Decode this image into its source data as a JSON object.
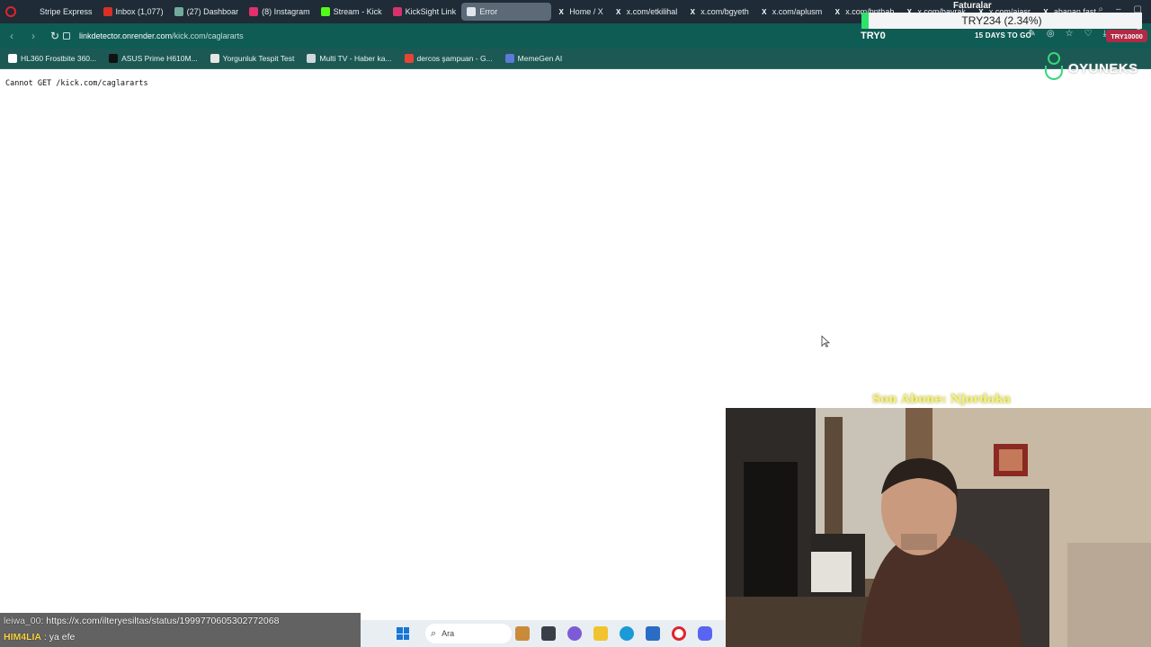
{
  "tabs": [
    {
      "label": "Stripe Express",
      "icon": "stripe-icon",
      "color": "#1f2b36",
      "active": false
    },
    {
      "label": "Inbox (1,077)",
      "icon": "gmail-icon",
      "color": "#d93025",
      "active": false
    },
    {
      "label": "(27) Dashboar",
      "icon": "chatgpt-icon",
      "color": "#74aa9c",
      "active": false
    },
    {
      "label": "(8) Instagram",
      "icon": "instagram-icon",
      "color": "#e1306c",
      "active": false
    },
    {
      "label": "Stream - Kick",
      "icon": "kick-icon",
      "color": "#53fc18",
      "active": false
    },
    {
      "label": "KickSight Link",
      "icon": "kicksight-icon",
      "color": "#d6336c",
      "active": false
    },
    {
      "label": "Error",
      "icon": "page-icon",
      "color": "#dfe6ee",
      "active": true
    },
    {
      "label": "Home / X",
      "icon": "x-icon",
      "color": "#000000",
      "active": false
    },
    {
      "label": "x.com/etkilihal",
      "icon": "x-icon",
      "color": "#000000",
      "active": false
    },
    {
      "label": "x.com/bgyeth",
      "icon": "x-icon",
      "color": "#000000",
      "active": false
    },
    {
      "label": "x.com/aplusm",
      "icon": "x-icon",
      "color": "#000000",
      "active": false
    },
    {
      "label": "x.com/bpthab",
      "icon": "x-icon",
      "color": "#000000",
      "active": false
    },
    {
      "label": "x.com/bayrak",
      "icon": "x-icon",
      "color": "#000000",
      "active": false
    },
    {
      "label": "x.com/aiasr",
      "icon": "x-icon",
      "color": "#000000",
      "active": false
    },
    {
      "label": "abanan.fast",
      "icon": "x-icon",
      "color": "#000000",
      "active": false
    }
  ],
  "toolbar": {
    "url_host": "linkdetector.onrender.com",
    "url_path": "/kick.com/caglararts"
  },
  "bookmarks": [
    {
      "label": "HL360 Frostbite 360...",
      "icon": "bookmark-icon-1",
      "color": "#ffffff"
    },
    {
      "label": "ASUS Prime H610M...",
      "icon": "bookmark-icon-2",
      "color": "#111111"
    },
    {
      "label": "Yorgunluk Tespit Test",
      "icon": "document-icon",
      "color": "#e6e6e6"
    },
    {
      "label": "Multi TV - Haber ka...",
      "icon": "tv-icon",
      "color": "#cfd8dc"
    },
    {
      "label": "dercos şampuan - G...",
      "icon": "google-icon",
      "color": "#ea4335"
    },
    {
      "label": "MemeGen AI",
      "icon": "memegen-icon",
      "color": "#5b7bd5"
    }
  ],
  "page": {
    "error_text": "Cannot GET /kick.com/caglararts"
  },
  "overlay": {
    "ticker_title": "Faturalar",
    "ticker_text": "TRY234 (2.34%)",
    "try_left": "TRY0",
    "days": "15 DAYS TO GO",
    "try_right": "TRY10000",
    "brand": "OYUNEKS",
    "sub_alert": "Son Abone: Njordaka"
  },
  "chat": [
    {
      "user": "leiwa_00",
      "message": ": https://x.com/ilteryesiltas/status/1999770605302772068"
    },
    {
      "user": "HIM4LIA",
      "message": " : ya efe"
    }
  ],
  "taskbar": {
    "search_placeholder": "Ara"
  },
  "colors": {
    "tabstrip": "#1f2b36",
    "toolbar": "#0f5c55",
    "bookmarks_bar": "#1c5954",
    "ticker_accent": "#2ee36a",
    "brand_green": "#37d87a",
    "sub_alert": "#f6f07a"
  }
}
